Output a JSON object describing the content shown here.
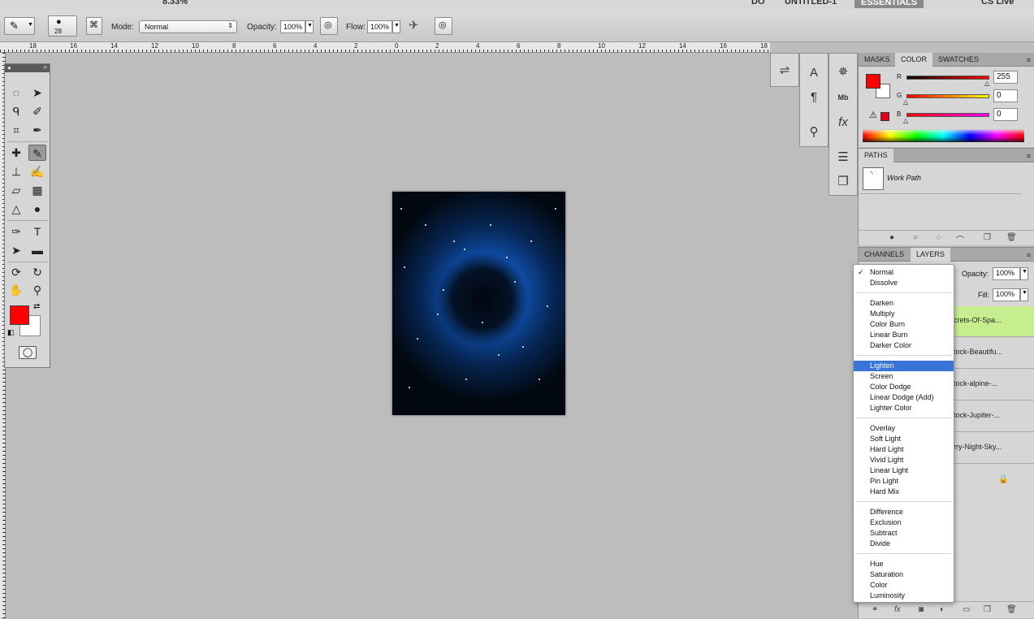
{
  "topbar": {
    "zoom": "8.33%",
    "mode_label": "DO",
    "doc_title": "UNTITLED-1",
    "workspace": "ESSENTIALS",
    "live": "CS Live"
  },
  "options": {
    "brush_size": "28",
    "mode_label": "Mode:",
    "mode_value": "Normal",
    "opacity_label": "Opacity:",
    "opacity_value": "100%",
    "flow_label": "Flow:",
    "flow_value": "100%"
  },
  "ruler": {
    "ticks": [
      "18",
      "16",
      "14",
      "12",
      "10",
      "8",
      "6",
      "4",
      "2",
      "0",
      "2",
      "4",
      "6",
      "8",
      "10",
      "12",
      "14",
      "16",
      "18"
    ]
  },
  "colors": {
    "foreground": "#ff0000",
    "background": "#ffffff",
    "accent": "#3875d7",
    "active_layer": "#c6ee8e"
  },
  "color_panel": {
    "tabs": [
      "MASKS",
      "COLOR",
      "SWATCHES"
    ],
    "r_label": "R",
    "g_label": "G",
    "b_label": "B",
    "r_value": "255",
    "g_value": "0",
    "b_value": "0"
  },
  "paths_panel": {
    "tab": "PATHS",
    "item": "Work Path"
  },
  "layers_panel": {
    "tabs": [
      "CHANNELS",
      "LAYERS"
    ],
    "opacity_label": "Opacity:",
    "opacity_value": "100%",
    "fill_label": "Fill:",
    "fill_value": "100%",
    "layers": [
      "crets-Of-Spa...",
      "tock-Beautifu...",
      "tock-alpine-...",
      "tock-Jupiter-...",
      "rry-Night-Sky..."
    ]
  },
  "blend_menu": {
    "groups": [
      [
        "Normal",
        "Dissolve"
      ],
      [
        "Darken",
        "Multiply",
        "Color Burn",
        "Linear Burn",
        "Darker Color"
      ],
      [
        "Lighten",
        "Screen",
        "Color Dodge",
        "Linear Dodge (Add)",
        "Lighter Color"
      ],
      [
        "Overlay",
        "Soft Light",
        "Hard Light",
        "Vivid Light",
        "Linear Light",
        "Pin Light",
        "Hard Mix"
      ],
      [
        "Difference",
        "Exclusion",
        "Subtract",
        "Divide"
      ],
      [
        "Hue",
        "Saturation",
        "Color",
        "Luminosity"
      ]
    ],
    "checked": "Normal",
    "highlighted": "Lighten"
  }
}
